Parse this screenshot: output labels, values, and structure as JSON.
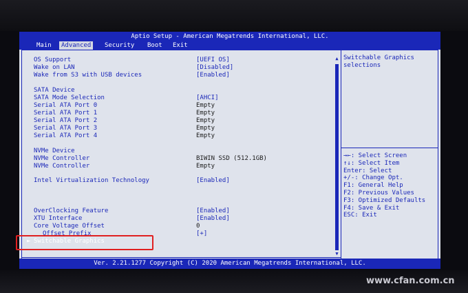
{
  "title": "Aptio Setup - American Megatrends International, LLC.",
  "menu": {
    "main": "Main",
    "advanced": "Advanced",
    "security": "Security",
    "boot": "Boot",
    "exit": "Exit"
  },
  "settings": {
    "os_support": {
      "label": "OS Support",
      "value": "[UEFI OS]"
    },
    "wake_on_lan": {
      "label": "Wake on LAN",
      "value": "[Disabled]"
    },
    "wake_usb": {
      "label": "Wake from S3 with USB devices",
      "value": "[Enabled]"
    },
    "sata_device": {
      "label": "SATA Device"
    },
    "sata_mode": {
      "label": "SATA Mode Selection",
      "value": "[AHCI]"
    },
    "sata_port0": {
      "label": "Serial ATA Port 0",
      "value": "Empty"
    },
    "sata_port1": {
      "label": "Serial ATA Port 1",
      "value": "Empty"
    },
    "sata_port2": {
      "label": "Serial ATA Port 2",
      "value": "Empty"
    },
    "sata_port3": {
      "label": "Serial ATA Port 3",
      "value": "Empty"
    },
    "sata_port4": {
      "label": "Serial ATA Port 4",
      "value": "Empty"
    },
    "nvme_device": {
      "label": "NVMe Device"
    },
    "nvme_controller1": {
      "label": "NVMe Controller",
      "value": "BIWIN SSD (512.1GB)"
    },
    "nvme_controller2": {
      "label": "NVMe Controller",
      "value": "Empty"
    },
    "intel_vt": {
      "label": "Intel Virtualization Technology",
      "value": "[Enabled]"
    },
    "overclocking": {
      "label": "OverClocking Feature",
      "value": "[Enabled]"
    },
    "xtu": {
      "label": "XTU Interface",
      "value": "[Enabled]"
    },
    "core_voltage": {
      "label": "Core Voltage Offset",
      "value": "0"
    },
    "offset_prefix": {
      "label": "Offset Prefix",
      "value": "[+]"
    },
    "switchable_graphics": {
      "label": "Switchable Graphics"
    }
  },
  "help": {
    "description": "Switchable Graphics selections",
    "keys": [
      "→←: Select Screen",
      "↑↓: Select Item",
      "Enter: Select",
      "+/-: Change Opt.",
      "F1: General Help",
      "F2: Previous Values",
      "F3: Optimized Defaults",
      "F4: Save & Exit",
      "ESC: Exit"
    ]
  },
  "footer": "Ver. 2.21.1277 Copyright (C) 2020 American Megatrends International, LLC.",
  "watermark": "www.cfan.com.cn",
  "colors": {
    "bios_blue": "#1a27b8",
    "bios_background": "#dfe3ec",
    "highlight_box": "#e02020"
  }
}
